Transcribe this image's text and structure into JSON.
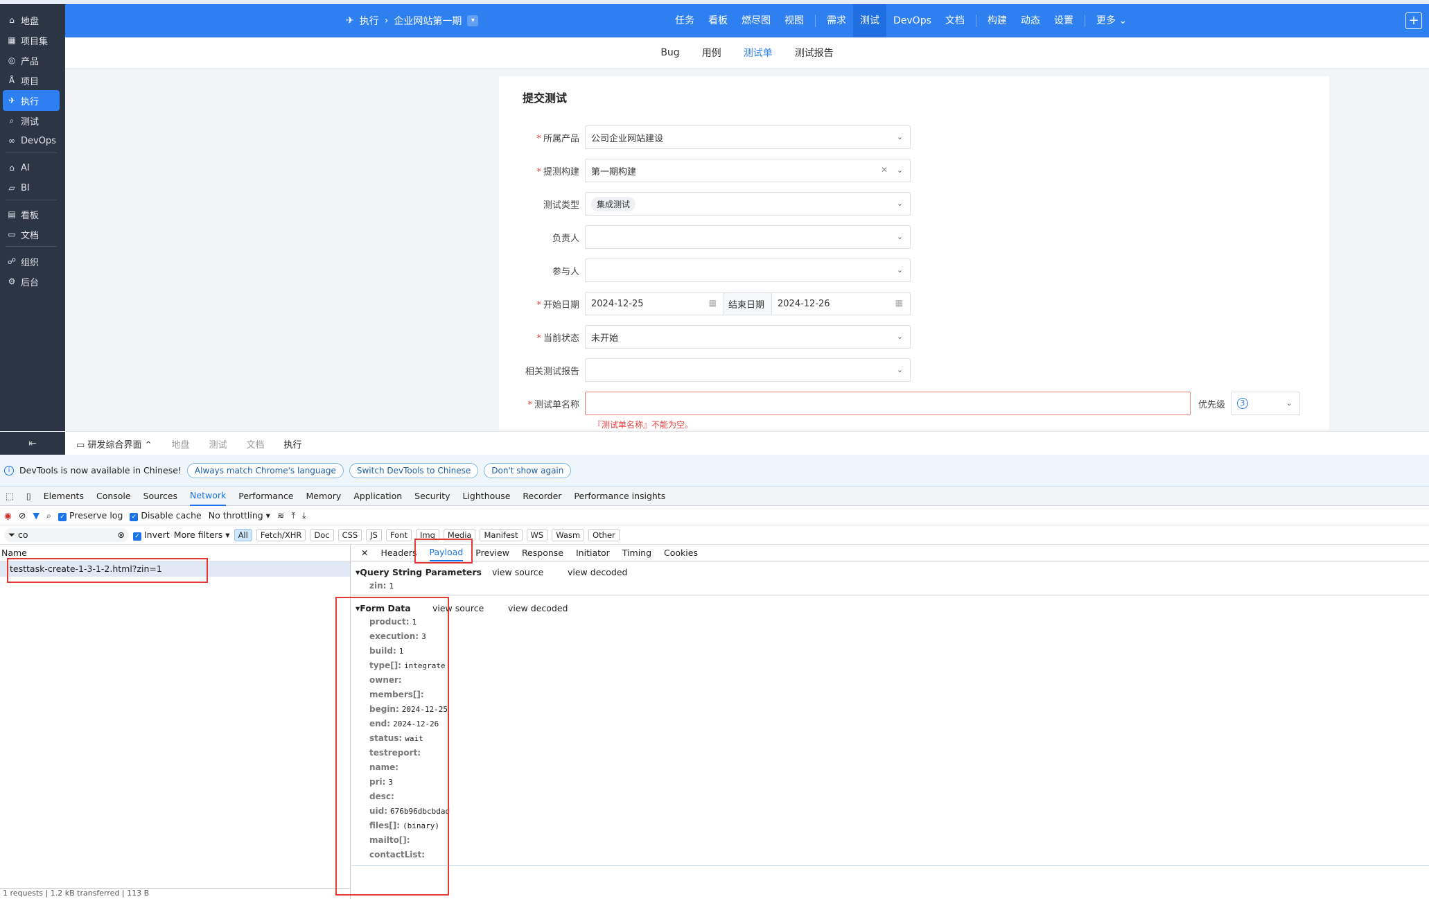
{
  "sidebar": {
    "items": [
      {
        "label": "地盘",
        "icon": "home-icon"
      },
      {
        "label": "项目集",
        "icon": "grid-icon"
      },
      {
        "label": "产品",
        "icon": "product-icon"
      },
      {
        "label": "项目",
        "icon": "project-icon"
      },
      {
        "label": "执行",
        "icon": "execution-icon"
      },
      {
        "label": "测试",
        "icon": "test-icon"
      },
      {
        "label": "DevOps",
        "icon": "infinity-icon"
      },
      {
        "label": "AI",
        "icon": "ai-icon"
      },
      {
        "label": "BI",
        "icon": "bi-icon"
      },
      {
        "label": "看板",
        "icon": "kanban-icon"
      },
      {
        "label": "文档",
        "icon": "doc-icon"
      },
      {
        "label": "组织",
        "icon": "org-icon"
      },
      {
        "label": "后台",
        "icon": "gear-icon"
      }
    ]
  },
  "topbar": {
    "crumb_root": "执行",
    "crumb_current": "企业网站第一期",
    "nav": [
      "任务",
      "看板",
      "燃尽图",
      "视图",
      "需求",
      "测试",
      "DevOps",
      "文档",
      "构建",
      "动态",
      "设置",
      "更多"
    ],
    "plus": "+"
  },
  "subnav": [
    "Bug",
    "用例",
    "测试单",
    "测试报告"
  ],
  "form": {
    "title": "提交测试",
    "product_label": "所属产品",
    "product_value": "公司企业网站建设",
    "build_label": "提测构建",
    "build_value": "第一期构建",
    "type_label": "测试类型",
    "type_value": "集成测试",
    "owner_label": "负责人",
    "members_label": "参与人",
    "begin_label": "开始日期",
    "begin_value": "2024-12-25",
    "end_label": "结束日期",
    "end_value": "2024-12-26",
    "status_label": "当前状态",
    "status_value": "未开始",
    "report_label": "相关测试报告",
    "name_label": "测试单名称",
    "name_error": "『测试单名称』不能为空。",
    "pri_label": "优先级",
    "pri_value": "3"
  },
  "bottombar": {
    "collapse": "⇤",
    "workspace": "研发综合界面",
    "items": [
      "地盘",
      "测试",
      "文档",
      "执行"
    ]
  },
  "devtools": {
    "info": "DevTools is now available in Chinese!",
    "info_buttons": [
      "Always match Chrome's language",
      "Switch DevTools to Chinese",
      "Don't show again"
    ],
    "tabs": [
      "Elements",
      "Console",
      "Sources",
      "Network",
      "Performance",
      "Memory",
      "Application",
      "Security",
      "Lighthouse",
      "Recorder",
      "Performance insights"
    ],
    "preserve_log": "Preserve log",
    "disable_cache": "Disable cache",
    "throttling": "No throttling",
    "filter_value": "co",
    "invert": "Invert",
    "more_filters": "More filters",
    "filter_types": [
      "All",
      "Fetch/XHR",
      "Doc",
      "CSS",
      "JS",
      "Font",
      "Img",
      "Media",
      "Manifest",
      "WS",
      "Wasm",
      "Other"
    ],
    "name_header": "Name",
    "request": "testtask-create-1-3-1-2.html?zin=1",
    "footer": "1 requests | 1.2 kB transferred | 113 B",
    "detail_tabs": [
      "Headers",
      "Payload",
      "Preview",
      "Response",
      "Initiator",
      "Timing",
      "Cookies"
    ],
    "qs_title": "Query String Parameters",
    "view_source": "view source",
    "view_decoded": "view decoded",
    "qs_params": [
      {
        "k": "zin:",
        "v": "1"
      }
    ],
    "fd_title": "Form Data",
    "form_data": [
      {
        "k": "product:",
        "v": "1"
      },
      {
        "k": "execution:",
        "v": "3"
      },
      {
        "k": "build:",
        "v": "1"
      },
      {
        "k": "type[]:",
        "v": "integrate"
      },
      {
        "k": "owner:",
        "v": ""
      },
      {
        "k": "members[]:",
        "v": ""
      },
      {
        "k": "begin:",
        "v": "2024-12-25"
      },
      {
        "k": "end:",
        "v": "2024-12-26"
      },
      {
        "k": "status:",
        "v": "wait"
      },
      {
        "k": "testreport:",
        "v": ""
      },
      {
        "k": "name:",
        "v": ""
      },
      {
        "k": "pri:",
        "v": "3"
      },
      {
        "k": "desc:",
        "v": ""
      },
      {
        "k": "uid:",
        "v": "676b96dbcbdad"
      },
      {
        "k": "files[]:",
        "v": "(binary)"
      },
      {
        "k": "mailto[]:",
        "v": ""
      },
      {
        "k": "contactList:",
        "v": ""
      }
    ]
  },
  "colors": {
    "primary": "#2e7ff0",
    "sidebar": "#2b3544",
    "annotation": "#e53935",
    "error": "#e53e3e"
  }
}
